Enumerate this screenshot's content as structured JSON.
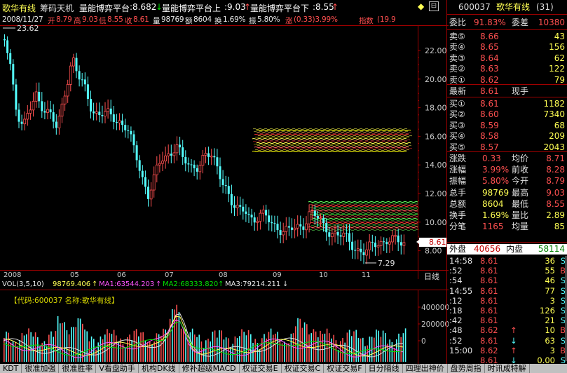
{
  "header": {
    "name": "歌华有线",
    "menu": "筹码天机",
    "ind_name": "量能博弈平台",
    "ind1": ":8.682",
    "ind2_label": "量能博弈平台上",
    "ind2": ":9.03",
    "ind3_label": "量能博弈平台下",
    "ind3": ":8.55"
  },
  "info": {
    "date": "2008/11/27",
    "open_l": "开",
    "open": "8.79",
    "high_l": "高",
    "high": "9.03",
    "low_l": "低",
    "low": "8.55",
    "close_l": "收",
    "close": "8.61",
    "vol_l": "量",
    "vol": "98769",
    "amt_l": "额",
    "amt": "8604",
    "turn_l": "换",
    "turn": "1.69%",
    "amp_l": "振",
    "amp": "5.80%",
    "chg_l": "涨",
    "chg": "(0.33)3.99%",
    "idx_l": "指数",
    "idx": "(19.9"
  },
  "axis": {
    "y": [
      "22.00",
      "20.00",
      "18.00",
      "16.00",
      "14.00",
      "12.00",
      "10.00",
      "8.00"
    ],
    "dates": [
      "2008",
      "05",
      "06",
      "07",
      "08",
      "09",
      "10",
      "11"
    ],
    "period": "日线",
    "hi_label": "23.62",
    "lo_label": "7.29",
    "last": "8.61"
  },
  "vol": {
    "title": "VOL(3,5,10)",
    "v": "98769.406",
    "ma1": "MA1:63544.203",
    "ma2": "MA2:68333.820",
    "ma3": "MA3:79214.211",
    "stock_label": "【代码:600037 名称:歌华有线】",
    "ticks": [
      "400000",
      "200000",
      "0"
    ]
  },
  "tabs": [
    "KDT",
    "很准加强",
    "很准胜率",
    "V看盘助手",
    "机构DK线",
    "修补超级MACD",
    "权证交易E",
    "权证交易C",
    "权证交易F",
    "日分隔线",
    "四理出神价",
    "盘势周指",
    "时讯成特解"
  ],
  "quote": {
    "code": "600037",
    "name": "歌华有线",
    "num": "(31)",
    "wb_l": "委比",
    "wb": "91.83%",
    "wc_l": "委差",
    "wc": "10380",
    "sells": [
      {
        "l": "卖⑤",
        "p": "8.66",
        "v": "43"
      },
      {
        "l": "卖④",
        "p": "8.65",
        "v": "156"
      },
      {
        "l": "卖③",
        "p": "8.64",
        "v": "62"
      },
      {
        "l": "卖②",
        "p": "8.63",
        "v": "122"
      },
      {
        "l": "卖①",
        "p": "8.62",
        "v": "79"
      }
    ],
    "last_l": "最新",
    "last": "8.61",
    "cur_l": "现手",
    "buys": [
      {
        "l": "买①",
        "p": "8.61",
        "v": "1182"
      },
      {
        "l": "买②",
        "p": "8.60",
        "v": "7340"
      },
      {
        "l": "买③",
        "p": "8.59",
        "v": "68"
      },
      {
        "l": "买④",
        "p": "8.58",
        "v": "209"
      },
      {
        "l": "买⑤",
        "p": "8.57",
        "v": "2043"
      }
    ],
    "stats": [
      [
        "涨跌",
        "0.33",
        "均价",
        "8.71"
      ],
      [
        "涨幅",
        "3.99%",
        "前收",
        "8.28"
      ],
      [
        "振幅",
        "5.80%",
        "今开",
        "8.79"
      ],
      [
        "总手",
        "98769",
        "最高",
        "9.03"
      ],
      [
        "总额",
        "8604",
        "最低",
        "8.55"
      ],
      [
        "换手",
        "1.69%",
        "量比",
        "2.89"
      ],
      [
        "分笔",
        "1165",
        "均量",
        "85"
      ]
    ],
    "outer_l": "外盘",
    "outer": "40656",
    "inner_l": "内盘",
    "inner": "58114",
    "ticks": [
      {
        "t": "14:58",
        "p": "8.61",
        "a": "",
        "v": "36",
        "s": "S"
      },
      {
        "t": ":52",
        "p": "8.61",
        "a": "",
        "v": "55",
        "s": "B"
      },
      {
        "t": ":54",
        "p": "8.61",
        "a": "",
        "v": "46",
        "s": "S"
      },
      {
        "t": "14:55",
        "p": "8.61",
        "a": "",
        "v": "77",
        "s": "S"
      },
      {
        "t": ":12",
        "p": "8.61",
        "a": "",
        "v": "3",
        "s": "S"
      },
      {
        "t": ":18",
        "p": "8.61",
        "a": "",
        "v": "126",
        "s": "S"
      },
      {
        "t": ":42",
        "p": "8.61",
        "a": "",
        "v": "21",
        "s": "S"
      },
      {
        "t": ":48",
        "p": "8.62",
        "a": "↑",
        "v": "10",
        "s": "B"
      },
      {
        "t": ":52",
        "p": "8.61",
        "a": "↓",
        "v": "63",
        "s": "S"
      },
      {
        "t": "15:00",
        "p": "8.62",
        "a": "↑",
        "v": "3",
        "s": "B"
      },
      {
        "t": "",
        "p": "8.61",
        "a": "↓",
        "v": "0.00",
        "s": "S"
      }
    ]
  },
  "colors": {
    "up": "#ff5050",
    "down": "#54ffff",
    "frame": "#a00000"
  }
}
